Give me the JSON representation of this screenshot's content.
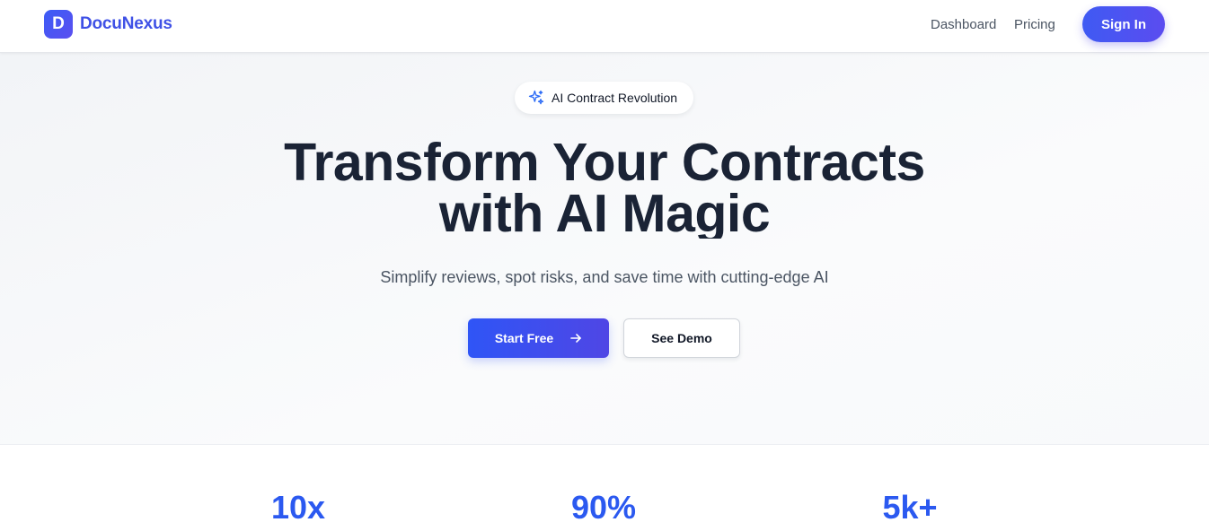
{
  "brand": {
    "logo_letter": "D",
    "name": "DocuNexus"
  },
  "nav": {
    "links": [
      {
        "label": "Dashboard"
      },
      {
        "label": "Pricing"
      }
    ],
    "sign_in_label": "Sign In"
  },
  "hero": {
    "badge": {
      "icon": "sparkles-icon",
      "label": "AI Contract Revolution"
    },
    "headline_line1": "Transform Your Contracts",
    "headline_line2": "with AI Magic",
    "subtitle": "Simplify reviews, spot risks, and save time with cutting-edge AI",
    "primary_cta": {
      "label": "Start Free",
      "icon": "arrow-right-icon"
    },
    "secondary_cta": {
      "label": "See Demo"
    }
  },
  "stats": [
    {
      "value": "10x"
    },
    {
      "value": "90%"
    },
    {
      "value": "5k+"
    }
  ],
  "colors": {
    "brand_accent": "#3f51e6",
    "primary_gradient_start": "#2f55f6",
    "primary_gradient_end": "#4f46e5",
    "stat_color": "#2b59f0"
  }
}
